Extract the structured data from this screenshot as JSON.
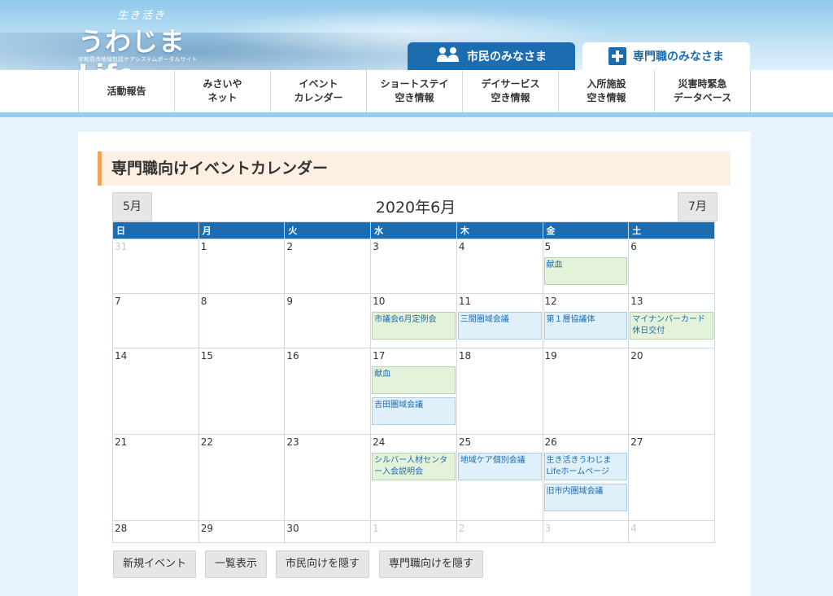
{
  "header": {
    "logo_sub": "生き活き",
    "logo_main": "うわじまLife",
    "logo_tag": "宇和島市地域包括ケアシステムポータルサイト",
    "tab_citizen": "市民のみなさま",
    "tab_pro": "専門職のみなさま"
  },
  "nav": [
    "活動報告",
    "みさいや\nネット",
    "イベント\nカレンダー",
    "ショートステイ\n空き情報",
    "デイサービス\n空き情報",
    "入所施設\n空き情報",
    "災害時緊急\nデータベース"
  ],
  "main": {
    "title": "専門職向けイベントカレンダー",
    "prev": "5月",
    "next": "7月",
    "month": "2020年6月"
  },
  "calendar": {
    "weekdays": [
      "日",
      "月",
      "火",
      "水",
      "木",
      "金",
      "土"
    ],
    "weeks": [
      [
        {
          "d": "31",
          "o": true
        },
        {
          "d": "1"
        },
        {
          "d": "2"
        },
        {
          "d": "3"
        },
        {
          "d": "4"
        },
        {
          "d": "5",
          "ev": [
            {
              "t": "献血",
              "c": "green",
              "h": 2
            }
          ]
        },
        {
          "d": "6"
        }
      ],
      [
        {
          "d": "7"
        },
        {
          "d": "8"
        },
        {
          "d": "9"
        },
        {
          "d": "10",
          "ev": [
            {
              "t": "市議会6月定例会",
              "c": "green",
              "h": 2
            }
          ]
        },
        {
          "d": "11",
          "ev": [
            {
              "t": "三間圏域会議",
              "c": "blue",
              "h": 2
            }
          ]
        },
        {
          "d": "12",
          "ev": [
            {
              "t": "第１層協議体",
              "c": "blue",
              "h": 2
            }
          ]
        },
        {
          "d": "13",
          "ev": [
            {
              "t": "マイナンバーカード休日交付",
              "c": "green",
              "h": 2
            }
          ]
        }
      ],
      [
        {
          "d": "14"
        },
        {
          "d": "15"
        },
        {
          "d": "16"
        },
        {
          "d": "17",
          "ev": [
            {
              "t": "献血",
              "c": "green",
              "h": 2
            },
            {
              "t": "吉田圏域会議",
              "c": "blue",
              "h": 2
            }
          ]
        },
        {
          "d": "18"
        },
        {
          "d": "19"
        },
        {
          "d": "20"
        }
      ],
      [
        {
          "d": "21"
        },
        {
          "d": "22"
        },
        {
          "d": "23"
        },
        {
          "d": "24",
          "ev": [
            {
              "t": "シルバー人材センター入会説明会",
              "c": "green",
              "h": 2
            }
          ]
        },
        {
          "d": "25",
          "ev": [
            {
              "t": "地域ケア個別会議",
              "c": "blue",
              "h": 2
            }
          ]
        },
        {
          "d": "26",
          "ev": [
            {
              "t": "生き活きうわじまLifeホームページ",
              "c": "blue",
              "h": 2
            },
            {
              "t": "旧市内圏域会議",
              "c": "blue",
              "h": 2
            }
          ]
        },
        {
          "d": "27"
        }
      ],
      [
        {
          "d": "28"
        },
        {
          "d": "29"
        },
        {
          "d": "30"
        },
        {
          "d": "1",
          "o": true
        },
        {
          "d": "2",
          "o": true
        },
        {
          "d": "3",
          "o": true
        },
        {
          "d": "4",
          "o": true
        }
      ]
    ]
  },
  "buttons": {
    "new_event": "新規イベント",
    "list_view": "一覧表示",
    "hide_citizen": "市民向けを隠す",
    "hide_pro": "専門職向けを隠す"
  }
}
